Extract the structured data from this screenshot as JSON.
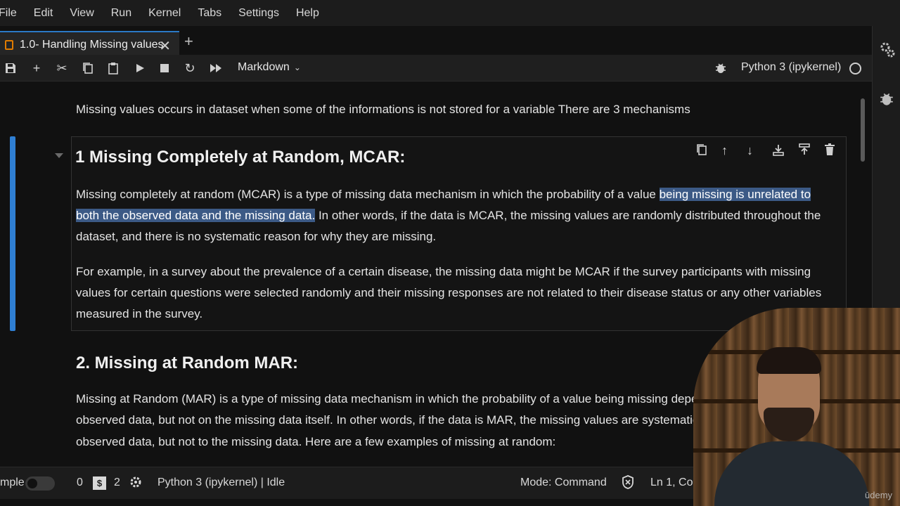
{
  "menu": [
    "File",
    "Edit",
    "View",
    "Run",
    "Kernel",
    "Tabs",
    "Settings",
    "Help"
  ],
  "tab": {
    "title": "1.0- Handling Missing values",
    "close": "✕",
    "add": "+"
  },
  "toolbar": {
    "cell_type": "Markdown",
    "kernel": "Python 3 (ipykernel)"
  },
  "notebook": {
    "intro": "Missing values occurs in dataset when some of the informations is not stored for a variable There are 3 mechanisms",
    "mcar_heading": "1 Missing Completely at Random, MCAR:",
    "mcar_p1_line1_a": "Missing completely at random (MCAR) is a type of missing data mechanism in which the probability of a value ",
    "mcar_p1_line1_sel": "being missing is unrelated to",
    "mcar_p1_line2_sel": "both the observed data and the missing data.",
    "mcar_p1_line2_b": " In other words, if the data is MCAR, the missing values are randomly distributed throughout the",
    "mcar_p1_line3": "dataset, and there is no systematic reason for why they are missing.",
    "mcar_p2_line1": "For example, in a survey about the prevalence of a certain disease, the missing data might be MCAR if the survey participants with missing",
    "mcar_p2_line2": "values for certain questions were selected randomly and their missing responses are not related to their disease status or any other variables",
    "mcar_p2_line3": "measured in the survey.",
    "mar_heading": "2. Missing at Random MAR:",
    "mar_line1": "Missing at Random (MAR) is a type of missing data mechanism in which the probability of a value being missing depe",
    "mar_line2": "observed data, but not on the missing data itself. In other words, if the data is MAR, the missing values are systematic",
    "mar_line3": "observed data, but not to the missing data. Here are a few examples of missing at random:"
  },
  "status": {
    "mode_label": "mple",
    "count_a": "0",
    "count_b": "2",
    "kernel_status": "Python 3 (ipykernel) | Idle",
    "mode": "Mode: Command",
    "position": "Ln 1, Col 1"
  },
  "watermark": "ūdemy"
}
